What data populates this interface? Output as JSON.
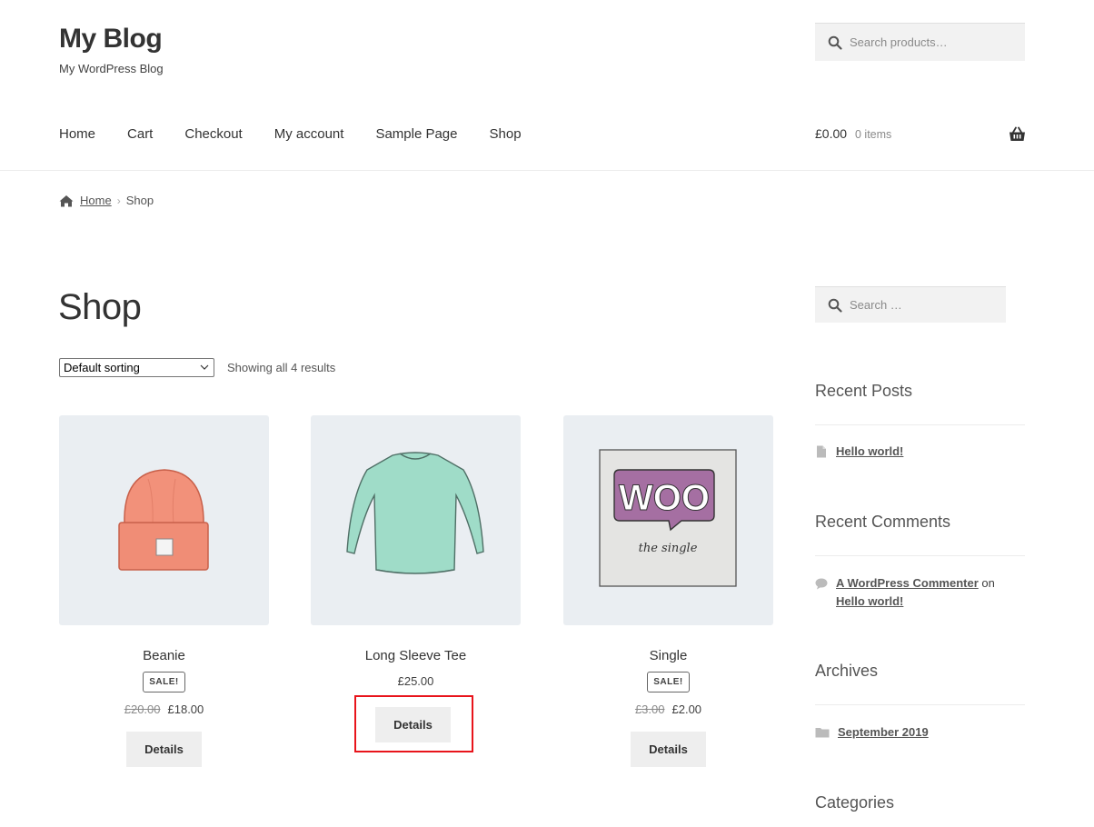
{
  "site": {
    "title": "My Blog",
    "description": "My WordPress Blog"
  },
  "header_search": {
    "placeholder": "Search products…"
  },
  "nav": [
    "Home",
    "Cart",
    "Checkout",
    "My account",
    "Sample Page",
    "Shop"
  ],
  "cart": {
    "total": "£0.00",
    "count": "0 items"
  },
  "breadcrumb": {
    "home": "Home",
    "current": "Shop"
  },
  "page": {
    "title": "Shop",
    "sort_selected": "Default sorting",
    "result_count": "Showing all 4 results"
  },
  "products": [
    {
      "name": "Beanie",
      "sale_label": "SALE!",
      "old_price": "£20.00",
      "price": "£18.00",
      "button": "Details"
    },
    {
      "name": "Long Sleeve Tee",
      "price": "£25.00",
      "button": "Details"
    },
    {
      "name": "Single",
      "sale_label": "SALE!",
      "old_price": "£3.00",
      "price": "£2.00",
      "button": "Details",
      "image_text": "WOO",
      "image_caption": "the single"
    }
  ],
  "sidebar": {
    "search_placeholder": "Search …",
    "recent_posts": {
      "title": "Recent Posts",
      "items": [
        "Hello world!"
      ]
    },
    "recent_comments": {
      "title": "Recent Comments",
      "author": "A WordPress Commenter",
      "on": "on",
      "post": "Hello world!"
    },
    "archives": {
      "title": "Archives",
      "items": [
        "September 2019"
      ]
    },
    "categories": {
      "title": "Categories"
    }
  },
  "colors": {
    "highlight": "#e8141b",
    "thumb_bg": "#eaeef2",
    "button_bg": "#eeeeee"
  }
}
